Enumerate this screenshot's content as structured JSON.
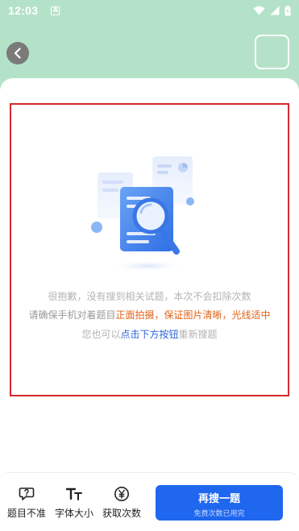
{
  "status": {
    "time": "12:03",
    "app_badge": "A"
  },
  "message": {
    "line1": "很抱歉，没有搜到相关试题，本次不会扣除次数",
    "line2_prefix": "请确保手机对着题目",
    "line2_highlight": "正面拍摄，保证图片清晰，光线适中",
    "line3_prefix": "您也可以",
    "line3_highlight": "点击下方按钮",
    "line3_suffix": "重新搜题"
  },
  "toolbar": {
    "inaccurate_label": "题目不准",
    "font_size_label": "字体大小",
    "get_count_label": "获取次数",
    "research_label": "再搜一题",
    "research_sub": "免费次数已用完"
  },
  "colors": {
    "header_bg": "#b4e2c9",
    "frame": "#d32a2e",
    "primary": "#1e67ee",
    "highlight_orange": "#e06318",
    "highlight_blue": "#2a66d9"
  }
}
